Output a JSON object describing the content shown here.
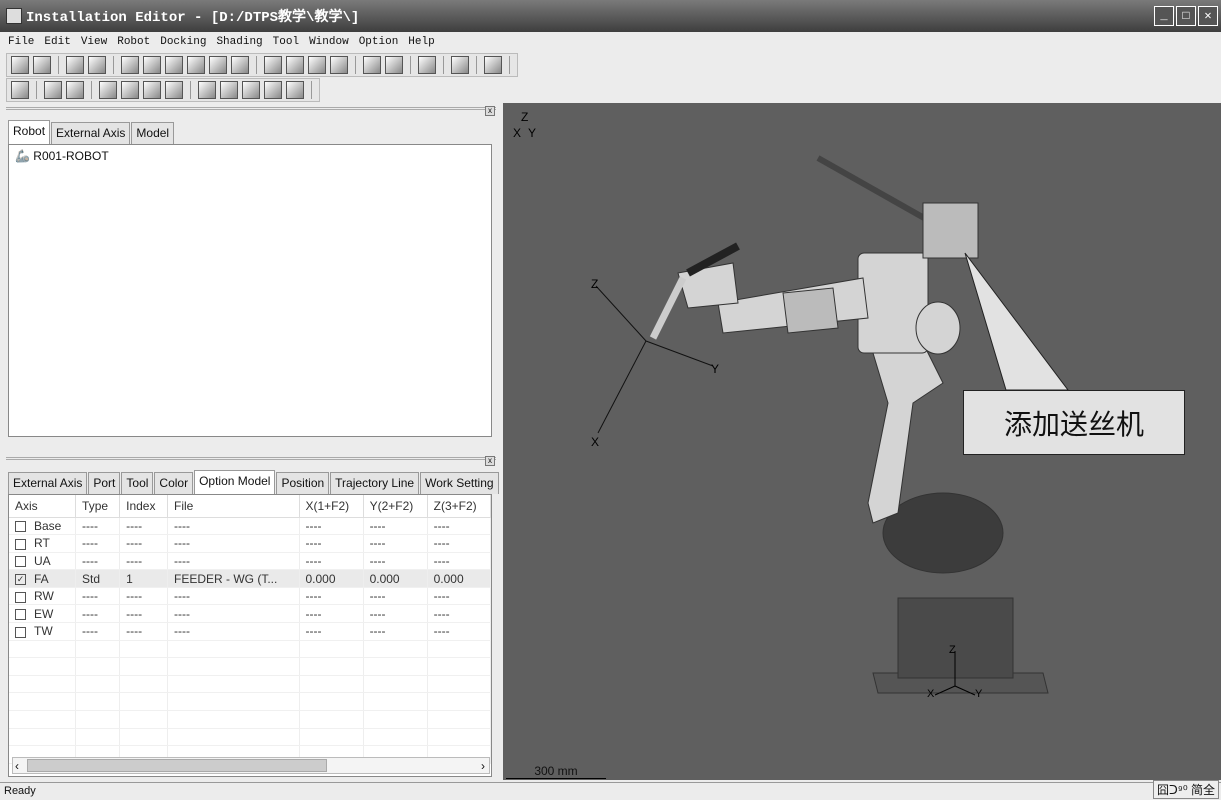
{
  "window": {
    "title": "Installation Editor - [D:/DTPS教学\\教学\\]"
  },
  "menu": [
    "File",
    "Edit",
    "View",
    "Robot",
    "Docking",
    "Shading",
    "Tool",
    "Window",
    "Option",
    "Help"
  ],
  "top_pane": {
    "tabs": [
      "Robot",
      "External Axis",
      "Model"
    ],
    "tree": [
      "R001-ROBOT"
    ]
  },
  "bottom_pane": {
    "tabs": [
      "External Axis",
      "Port",
      "Tool",
      "Color",
      "Option Model",
      "Position",
      "Trajectory Line",
      "Work Setting"
    ],
    "columns": [
      "Axis",
      "Type",
      "Index",
      "File",
      "X(1+F2)",
      "Y(2+F2)",
      "Z(3+F2)"
    ],
    "rows": [
      {
        "checked": false,
        "cells": [
          "Base",
          "----",
          "----",
          "----",
          "----",
          "----",
          "----"
        ]
      },
      {
        "checked": false,
        "cells": [
          "RT",
          "----",
          "----",
          "----",
          "----",
          "----",
          "----"
        ]
      },
      {
        "checked": false,
        "cells": [
          "UA",
          "----",
          "----",
          "----",
          "----",
          "----",
          "----"
        ]
      },
      {
        "checked": true,
        "cells": [
          "FA",
          "Std",
          "1",
          "FEEDER - WG (T...",
          "0.000",
          "0.000",
          "0.000"
        ]
      },
      {
        "checked": false,
        "cells": [
          "RW",
          "----",
          "----",
          "----",
          "----",
          "----",
          "----"
        ]
      },
      {
        "checked": false,
        "cells": [
          "EW",
          "----",
          "----",
          "----",
          "----",
          "----",
          "----"
        ]
      },
      {
        "checked": false,
        "cells": [
          "TW",
          "----",
          "----",
          "----",
          "----",
          "----",
          "----"
        ]
      }
    ]
  },
  "viewport": {
    "callout": "添加送丝机",
    "scale": "300 mm",
    "axes": {
      "x": "X",
      "y": "Y",
      "z": "Z"
    }
  },
  "status": {
    "text": "Ready",
    "ime": "囧ᑐ⁹⁰ 简全"
  }
}
